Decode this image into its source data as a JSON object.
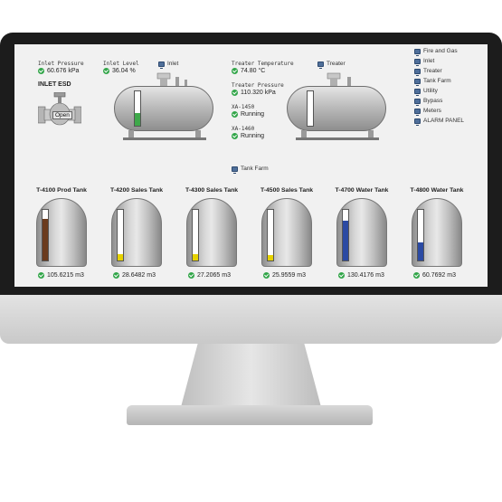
{
  "readouts": {
    "inlet_pressure": {
      "label": "Inlet Pressure",
      "value": "60.676 kPa"
    },
    "inlet_level": {
      "label": "Inlet Level",
      "value": "36.04 %"
    },
    "treater_temperature": {
      "label": "Treater Temperature",
      "value": "74.80 °C"
    },
    "treater_pressure": {
      "label": "Treater Pressure",
      "value": "110.320 kPa"
    },
    "xa1450": {
      "label": "XA-1450",
      "value": "Running"
    },
    "xa1460": {
      "label": "XA-1460",
      "value": "Running"
    }
  },
  "esd": {
    "title": "INLET ESD",
    "state": "Open"
  },
  "vessel_links": {
    "inlet": "Inlet",
    "treater": "Treater",
    "tank_farm": "Tank Farm"
  },
  "sidebar": {
    "items": [
      "Fire and Gas",
      "Inlet",
      "Treater",
      "Tank Farm",
      "Utility",
      "Bypass",
      "Meters",
      "ALARM PANEL"
    ]
  },
  "vessels": {
    "inlet_level_fraction": 0.36,
    "treater_level_fraction": 0.0
  },
  "tanks": [
    {
      "name": "T-4100 Prod Tank",
      "volume": "105.6215 m3",
      "level": 0.82,
      "color": "#6b3b1d"
    },
    {
      "name": "T-4200 Sales Tank",
      "volume": "28.6482 m3",
      "level": 0.12,
      "color": "#e6d200"
    },
    {
      "name": "T-4300 Sales Tank",
      "volume": "27.2065 m3",
      "level": 0.12,
      "color": "#e6d200"
    },
    {
      "name": "T-4500 Sales Tank",
      "volume": "25.9559 m3",
      "level": 0.11,
      "color": "#e6d200"
    },
    {
      "name": "T-4700 Water Tank",
      "volume": "130.4176 m3",
      "level": 0.78,
      "color": "#2b4aa3"
    },
    {
      "name": "T-4800 Water Tank",
      "volume": "60.7692 m3",
      "level": 0.35,
      "color": "#2b4aa3"
    }
  ],
  "colors": {
    "ok_status": "#33a64a",
    "inlet_fill": "#3ea84a"
  }
}
